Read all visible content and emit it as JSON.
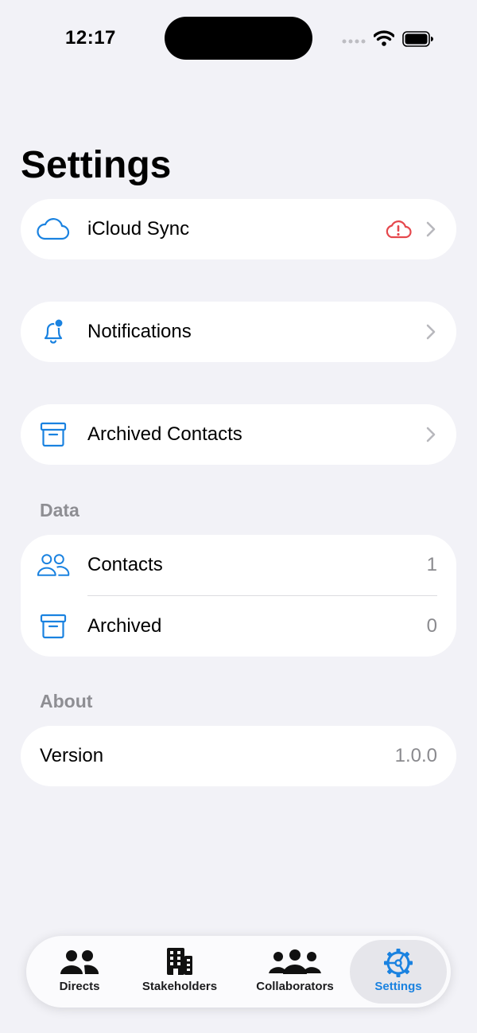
{
  "status_bar": {
    "time": "12:17"
  },
  "page": {
    "title": "Settings"
  },
  "rows": {
    "icloud": {
      "label": "iCloud Sync",
      "icon": "cloud-icon",
      "status_icon": "cloud-error-icon"
    },
    "notifications": {
      "label": "Notifications",
      "icon": "bell-badge-icon"
    },
    "archived_contacts": {
      "label": "Archived Contacts",
      "icon": "archivebox-icon"
    }
  },
  "data_section": {
    "header": "Data",
    "contacts": {
      "label": "Contacts",
      "value": "1",
      "icon": "people-icon"
    },
    "archived": {
      "label": "Archived",
      "value": "0",
      "icon": "archivebox-icon"
    }
  },
  "about_section": {
    "header": "About",
    "version": {
      "label": "Version",
      "value": "1.0.0"
    }
  },
  "tabs": [
    {
      "label": "Directs",
      "icon": "two-people-icon"
    },
    {
      "label": "Stakeholders",
      "icon": "building-icon"
    },
    {
      "label": "Collaborators",
      "icon": "three-people-icon"
    },
    {
      "label": "Settings",
      "icon": "gear-icon",
      "active": true
    }
  ],
  "colors": {
    "accent": "#1a82e0",
    "error": "#e5484d",
    "background": "#f2f2f7"
  }
}
